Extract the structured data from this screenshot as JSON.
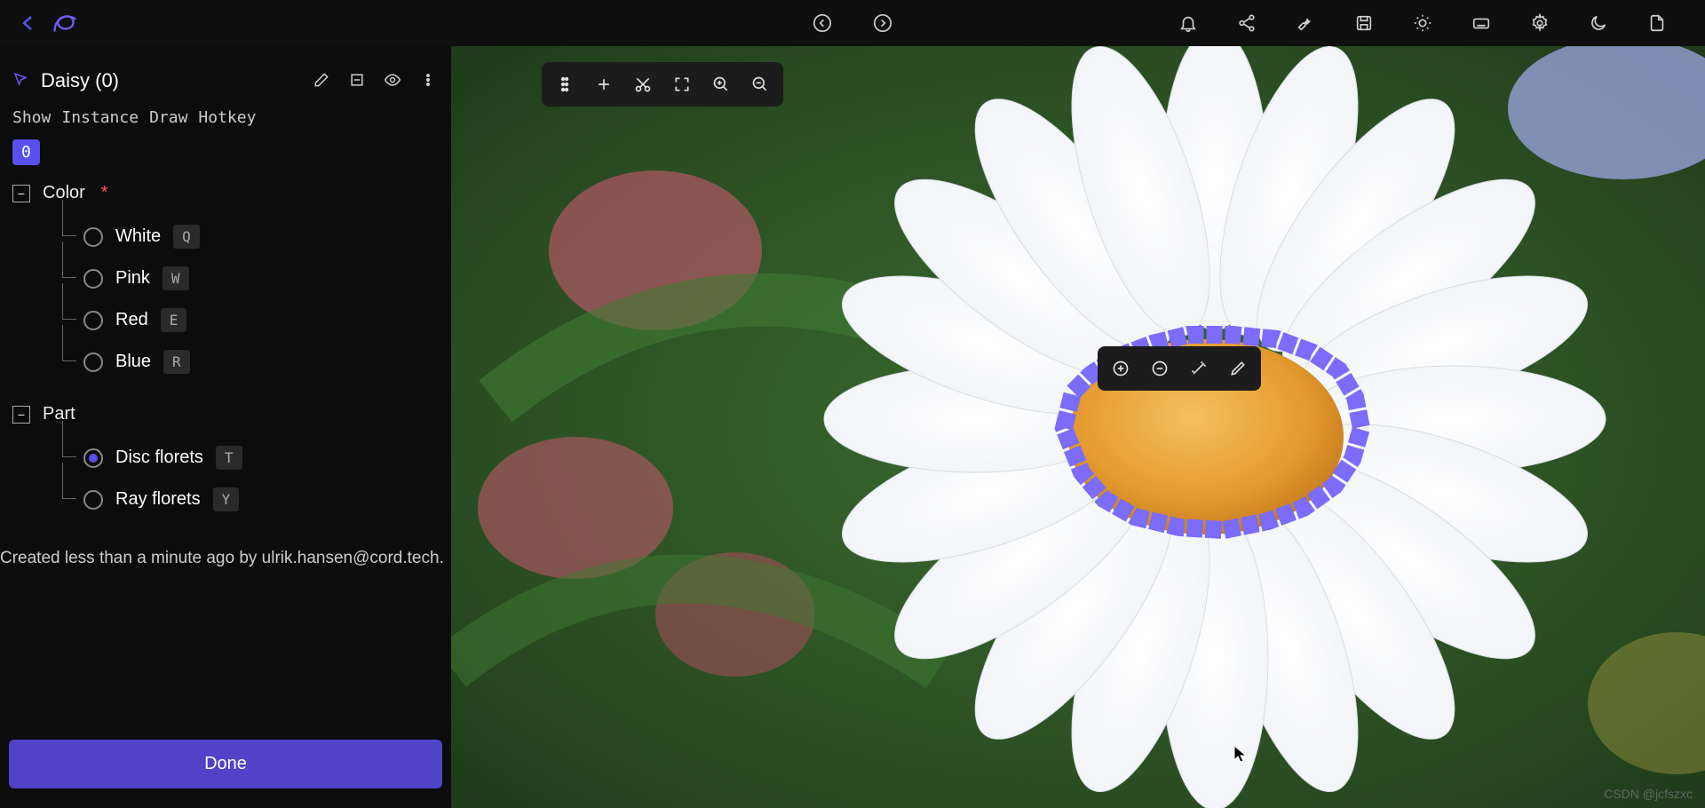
{
  "toolbar": {
    "label_title": "Daisy (0)",
    "tabs": [
      "Show",
      "Instance",
      "Draw",
      "Hotkey"
    ],
    "instance_id": "0"
  },
  "attributes": {
    "color": {
      "label": "Color",
      "required": "*",
      "options": [
        {
          "label": "White",
          "hotkey": "Q",
          "selected": false
        },
        {
          "label": "Pink",
          "hotkey": "W",
          "selected": false
        },
        {
          "label": "Red",
          "hotkey": "E",
          "selected": false
        },
        {
          "label": "Blue",
          "hotkey": "R",
          "selected": false
        }
      ]
    },
    "part": {
      "label": "Part",
      "options": [
        {
          "label": "Disc florets",
          "hotkey": "T",
          "selected": true
        },
        {
          "label": "Ray florets",
          "hotkey": "Y",
          "selected": false
        }
      ]
    }
  },
  "created_note": "Created less than a minute ago by ulrik.hansen@cord.tech.",
  "done_label": "Done",
  "watermark": "CSDN @jcfszxc",
  "colors": {
    "accent": "#5850ec",
    "annotation_outline": "#7c6cfa",
    "disc_fill": "#e9a33b"
  },
  "icons": {
    "back": "chevron-left",
    "logo": "encord-logo",
    "prev": "circle-chevron-left",
    "next": "circle-chevron-right",
    "bell": "bell",
    "share": "share",
    "wrench": "wrench",
    "save": "save",
    "brightness": "brightness",
    "keyboard": "keyboard",
    "settings": "gear",
    "moon": "moon",
    "export": "file-export"
  }
}
